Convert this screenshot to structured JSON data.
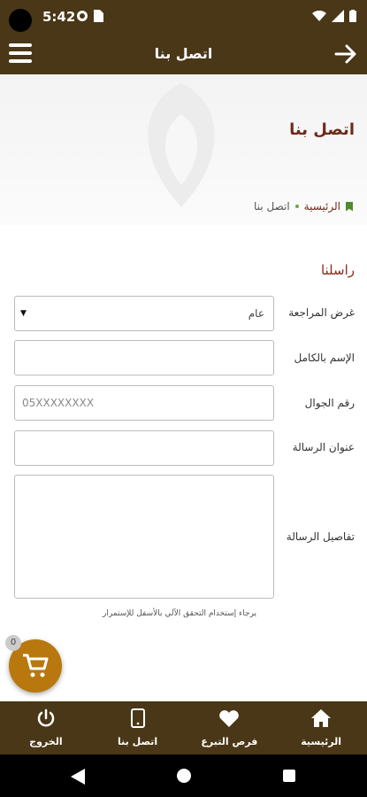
{
  "status_bar": {
    "time": "5:42"
  },
  "app_bar": {
    "title": "اتصل بنا"
  },
  "page": {
    "heading": "اتصل بنا",
    "breadcrumb": {
      "home": "الرئيسية",
      "current": "اتصل بنا"
    }
  },
  "form": {
    "section_title": "راسلنا",
    "fields": [
      {
        "label": "غرض المراجعة",
        "value": "عام"
      },
      {
        "label": "الإسم بالكامل",
        "value": ""
      },
      {
        "label": "رقم الجوال",
        "placeholder": "05XXXXXXXX"
      },
      {
        "label": "عنوان الرسالة",
        "value": ""
      },
      {
        "label": "تفاصيل الرسالة",
        "value": ""
      }
    ],
    "hint": "يرجاء إستخدام التحقق الآلي بالأسفل للإستمرار"
  },
  "cart": {
    "count": "0"
  },
  "bottom_nav": [
    {
      "label": "الرئيسية",
      "icon": "home-icon"
    },
    {
      "label": "فرص التبرع",
      "icon": "heart-icon"
    },
    {
      "label": "اتصل بنا",
      "icon": "phone-icon"
    },
    {
      "label": "الخروج",
      "icon": "power-icon"
    }
  ],
  "colors": {
    "primary": "#4a3717",
    "accent": "#b8780d",
    "heading": "#6b2b1a"
  }
}
